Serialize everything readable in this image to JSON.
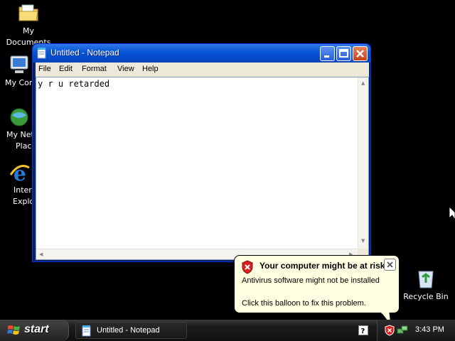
{
  "desktop": {
    "icons": [
      {
        "label": "My Documents",
        "icon": "folder-icon"
      },
      {
        "label": "My Com",
        "icon": "computer-icon"
      },
      {
        "label_line1": "My Net",
        "label_line2": "Plac",
        "icon": "network-places-icon"
      },
      {
        "label_line1": "Inter",
        "label_line2": "Explo",
        "icon": "internet-explorer-icon"
      },
      {
        "label": "Recycle Bin",
        "icon": "recycle-bin-icon"
      }
    ]
  },
  "notepad": {
    "title": "Untitled - Notepad",
    "menu": [
      "File",
      "Edit",
      "Format",
      "View",
      "Help"
    ],
    "content": "y r u retarded"
  },
  "balloon": {
    "title": "Your computer might be at risk",
    "line1": "Antivirus software might not be installed",
    "line2": "Click this balloon to fix this problem."
  },
  "taskbar": {
    "start_label": "start",
    "task_label": "Untitled - Notepad",
    "clock": "3:43 PM"
  },
  "colors": {
    "titlebar": "#0a58d8",
    "balloon_bg": "#ffffe1",
    "taskbar": "#1c1c1c",
    "desktop": "#000000"
  }
}
